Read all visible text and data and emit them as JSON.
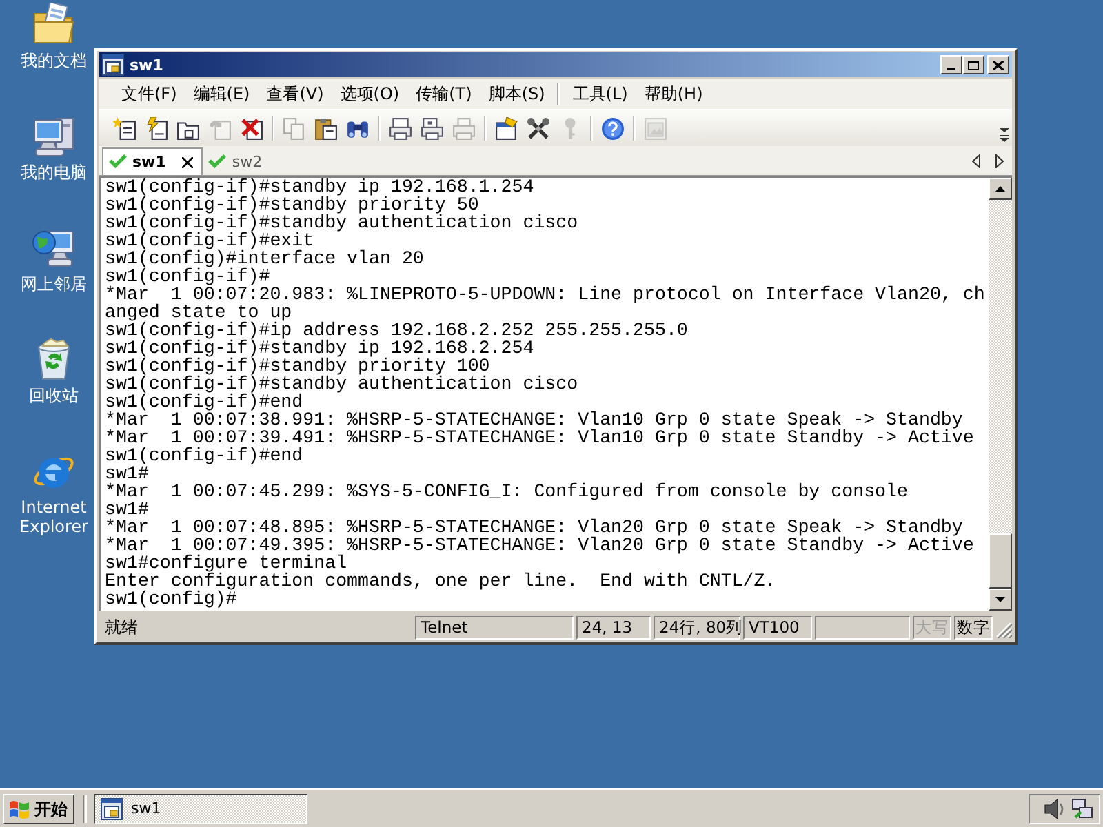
{
  "desktop_icons": [
    {
      "label": "我的文档"
    },
    {
      "label": "我的电脑"
    },
    {
      "label": "网上邻居"
    },
    {
      "label": "回收站"
    },
    {
      "label": "Internet Explorer"
    }
  ],
  "window": {
    "title": "sw1"
  },
  "menu": {
    "groups": [
      [
        "文件(F)",
        "编辑(E)",
        "查看(V)",
        "选项(O)",
        "传输(T)",
        "脚本(S)"
      ],
      [
        "工具(L)",
        "帮助(H)"
      ]
    ]
  },
  "toolbar": {
    "groups": [
      [
        {
          "disabled": false
        },
        {
          "disabled": false
        },
        {
          "disabled": false
        },
        {
          "disabled": true
        },
        {
          "disabled": false
        }
      ],
      [
        {
          "disabled": true
        },
        {
          "disabled": false
        },
        {
          "disabled": false
        }
      ],
      [
        {
          "disabled": false
        },
        {
          "disabled": false
        },
        {
          "disabled": true
        }
      ],
      [
        {
          "disabled": false
        },
        {
          "disabled": false
        },
        {
          "disabled": true
        }
      ],
      [
        {
          "disabled": false
        }
      ],
      [
        {
          "disabled": true
        }
      ]
    ]
  },
  "tabs": [
    {
      "label": "sw1",
      "selected": true,
      "connected": true
    },
    {
      "label": "sw2",
      "selected": false,
      "connected": true
    }
  ],
  "terminal": {
    "lines": [
      "sw1(config-if)#standby ip 192.168.1.254",
      "sw1(config-if)#standby priority 50",
      "sw1(config-if)#standby authentication cisco",
      "sw1(config-if)#exit",
      "sw1(config)#interface vlan 20",
      "sw1(config-if)#",
      "*Mar  1 00:07:20.983: %LINEPROTO-5-UPDOWN: Line protocol on Interface Vlan20, ch",
      "anged state to up",
      "sw1(config-if)#ip address 192.168.2.252 255.255.255.0",
      "sw1(config-if)#standby ip 192.168.2.254",
      "sw1(config-if)#standby priority 100",
      "sw1(config-if)#standby authentication cisco",
      "sw1(config-if)#end",
      "*Mar  1 00:07:38.991: %HSRP-5-STATECHANGE: Vlan10 Grp 0 state Speak -> Standby",
      "*Mar  1 00:07:39.491: %HSRP-5-STATECHANGE: Vlan10 Grp 0 state Standby -> Active",
      "sw1(config-if)#end",
      "sw1#",
      "*Mar  1 00:07:45.299: %SYS-5-CONFIG_I: Configured from console by console",
      "sw1#",
      "*Mar  1 00:07:48.895: %HSRP-5-STATECHANGE: Vlan20 Grp 0 state Speak -> Standby",
      "*Mar  1 00:07:49.395: %HSRP-5-STATECHANGE: Vlan20 Grp 0 state Standby -> Active",
      "sw1#configure terminal",
      "Enter configuration commands, one per line.  End with CNTL/Z.",
      "sw1(config)#"
    ]
  },
  "status_bar": {
    "message": "就绪",
    "panels": [
      "Telnet",
      "24, 13",
      "24行, 80列",
      "VT100"
    ],
    "indicators": [
      {
        "label": "大写",
        "on": false
      },
      {
        "label": "数字",
        "on": true
      }
    ]
  },
  "taskbar": {
    "start": "开始",
    "tasks": [
      {
        "label": "sw1",
        "selected": true
      }
    ]
  }
}
